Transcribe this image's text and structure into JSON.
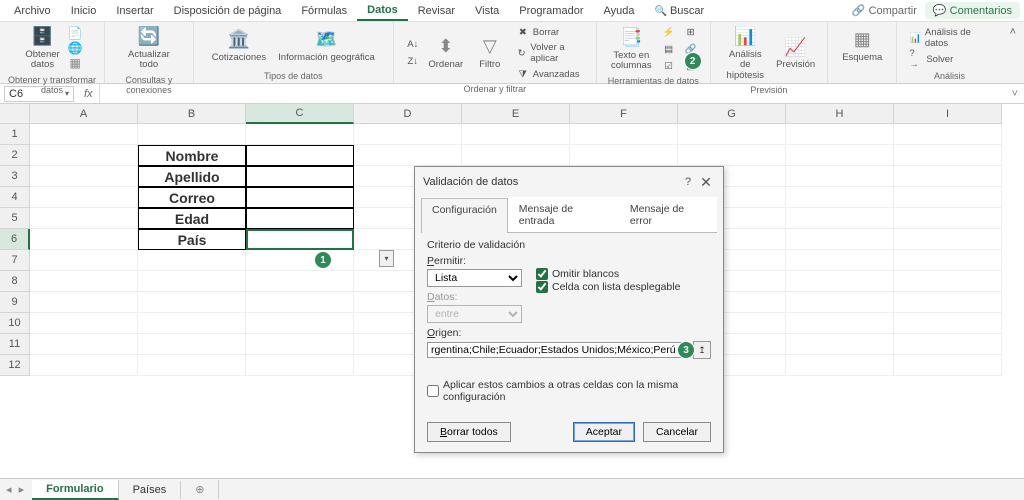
{
  "menu": {
    "archivo": "Archivo",
    "inicio": "Inicio",
    "insertar": "Insertar",
    "disposicion": "Disposición de página",
    "formulas": "Fórmulas",
    "datos": "Datos",
    "revisar": "Revisar",
    "vista": "Vista",
    "programador": "Programador",
    "ayuda": "Ayuda",
    "buscar": "Buscar",
    "compartir": "Compartir",
    "comentarios": "Comentarios"
  },
  "ribbon": {
    "get_transform": {
      "button": "Obtener\ndatos",
      "label": "Obtener y transformar datos"
    },
    "consultas": {
      "button": "Actualizar\ntodo",
      "label": "Consultas y conexiones"
    },
    "tipos": {
      "cot": "Cotizaciones",
      "geo": "Información geográfica",
      "label": "Tipos de datos"
    },
    "ordenar": {
      "ordenar": "Ordenar",
      "filtro": "Filtro",
      "borrar": "Borrar",
      "volver": "Volver a aplicar",
      "avanzadas": "Avanzadas",
      "label": "Ordenar y filtrar"
    },
    "herr": {
      "texto": "Texto en\ncolumnas",
      "label": "Herramientas de datos"
    },
    "prev": {
      "analisis": "Análisis de\nhipótesis",
      "prevision": "Previsión",
      "label": "Previsión"
    },
    "esquema": {
      "button": "Esquema",
      "label": ""
    },
    "analisis": {
      "ad": "Análisis de datos",
      "solver": "Solver",
      "label": "Análisis"
    }
  },
  "formula_bar": {
    "cell_ref": "C6",
    "fx": "fx"
  },
  "columns": [
    "A",
    "B",
    "C",
    "D",
    "E",
    "F",
    "G",
    "H",
    "I"
  ],
  "rows": [
    "1",
    "2",
    "3",
    "4",
    "5",
    "6",
    "7",
    "8",
    "9",
    "10",
    "11",
    "12"
  ],
  "table": {
    "r2": "Nombre",
    "r3": "Apellido",
    "r4": "Correo",
    "r5": "Edad",
    "r6": "País"
  },
  "badges": {
    "b1": "1",
    "b2": "2",
    "b3": "3"
  },
  "dialog": {
    "title": "Validación de datos",
    "help": "?",
    "close": "✕",
    "tabs": {
      "config": "Configuración",
      "mensaje": "Mensaje de entrada",
      "error": "Mensaje de error"
    },
    "criterio": "Criterio de validación",
    "permitir_lbl": "Permitir:",
    "permitir_val": "Lista",
    "datos_lbl": "Datos:",
    "datos_val": "entre",
    "omitir": "Omitir blancos",
    "celda": "Celda con lista desplegable",
    "origen_lbl": "Origen:",
    "origen_val": "rgentina;Chile;Ecuador;Estados Unidos;México;Perú",
    "aplicar": "Aplicar estos cambios a otras celdas con la misma configuración",
    "borrar": "Borrar todos",
    "aceptar": "Aceptar",
    "cancelar": "Cancelar"
  },
  "sheets": {
    "s1": "Formulario",
    "s2": "Países",
    "add": "⊕"
  }
}
